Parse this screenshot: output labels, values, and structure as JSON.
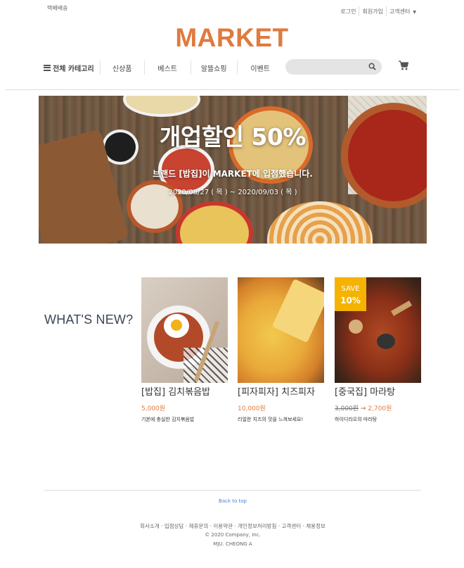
{
  "topbar": {
    "delivery": "택배배송",
    "login": "로그인",
    "signup": "회원가입",
    "support": "고객센터",
    "caret_icon": "caret-down-icon"
  },
  "logo": "MARKET",
  "nav": {
    "all_categories": "전체 카테고리",
    "menu_icon": "hamburger-icon",
    "items": [
      "신상품",
      "베스트",
      "알뜰쇼핑",
      "이벤트"
    ],
    "search_icon": "search-icon",
    "cart_icon": "cart-icon"
  },
  "banner": {
    "title": "개업할인 50%",
    "subtitle": "브랜드 [밥집]이 MARKET에 입점했습니다.",
    "date": "2020/08/27 ( 목 ) ~ 2020/09/03 ( 목 )"
  },
  "section_title": "WHAT'S NEW?",
  "products": [
    {
      "name": "[밥집] 김치볶음밥",
      "price": "5,000원",
      "desc": "기본에 충실한 김치볶음밥"
    },
    {
      "name": "[피자피자] 치즈피자",
      "price": "10,000원",
      "desc": "리얼한 치즈의 맛을 느껴보세요!"
    },
    {
      "name": "[중국집] 마라탕",
      "old_price": "3,000원",
      "arrow": "→",
      "price": "2,700원",
      "desc": "하이디라오의 마라탕",
      "badge": {
        "label": "SAVE",
        "value": "10%"
      }
    }
  ],
  "footer": {
    "back_to_top": "Back to top",
    "links": [
      "회사소개",
      "입점상담",
      "제휴문의",
      "이용약관",
      "개인정보처리방침",
      "고객센터",
      "채용정보"
    ],
    "copyright": "© 2020 Company, Inc.",
    "author": "MJU. CHEONG A"
  },
  "colors": {
    "brand": "#e07a3f",
    "badge": "#f5b300",
    "link": "#4a7fd0"
  }
}
